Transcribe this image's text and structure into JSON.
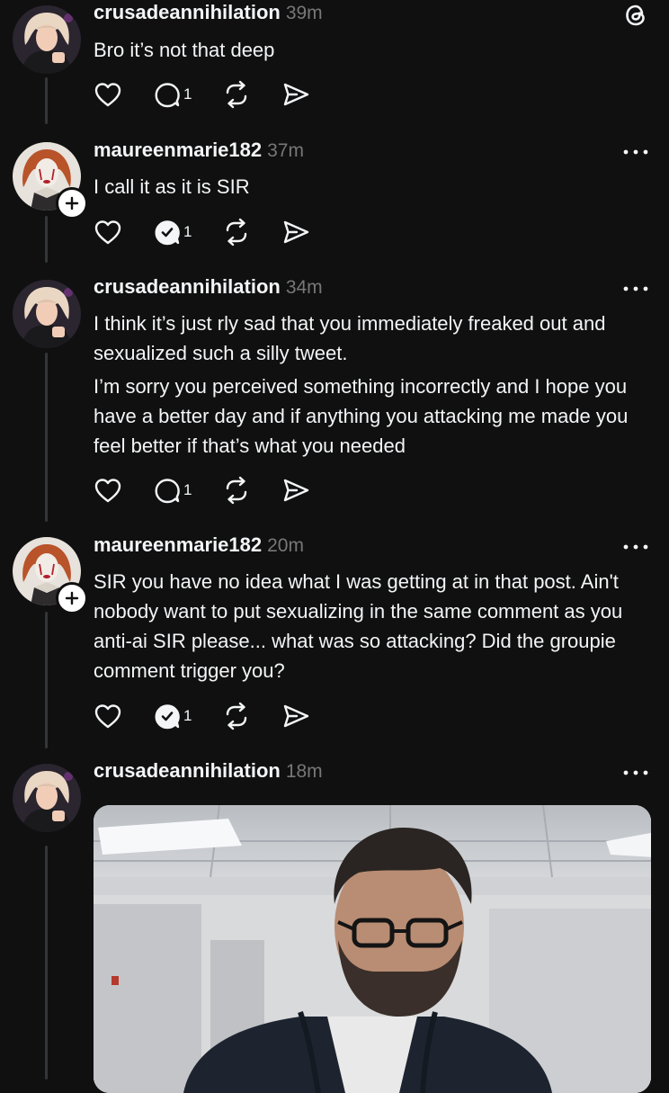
{
  "posts": [
    {
      "username": "crusadeannihilation",
      "time": "39m",
      "paragraphs": [
        "Bro it’s not that deep"
      ],
      "reply_count": "1",
      "replied_by_author": false
    },
    {
      "username": "maureenmarie182",
      "time": "37m",
      "paragraphs": [
        "I call it as it is SIR"
      ],
      "reply_count": "1",
      "replied_by_author": true
    },
    {
      "username": "crusadeannihilation",
      "time": "34m",
      "paragraphs": [
        "I think it’s just rly sad that you immediately freaked out and sexualized such a silly tweet.",
        "I’m sorry you perceived something incorrectly and I hope you have a better day and if anything you attacking me made you feel better if that’s what you needed"
      ],
      "reply_count": "1",
      "replied_by_author": false
    },
    {
      "username": "maureenmarie182",
      "time": "20m",
      "paragraphs": [
        "SIR you have no idea what I was getting at in that post. Ain't nobody want to put sexualizing in the same comment as you anti-ai SIR please... what was so attacking? Did the groupie comment trigger you?"
      ],
      "reply_count": "1",
      "replied_by_author": true
    },
    {
      "username": "crusadeannihilation",
      "time": "18m",
      "paragraphs": [],
      "has_image": true
    }
  ],
  "icons": {
    "like": "heart-icon",
    "reply": "speech-bubble-icon",
    "repost": "repost-icon",
    "share": "paper-plane-icon",
    "more": "more-dots-icon",
    "logo": "threads-logo-icon",
    "follow": "plus-icon"
  },
  "colors": {
    "background": "#101010",
    "text": "#f3f5f7",
    "muted": "#777777",
    "thread_line": "#333638"
  }
}
